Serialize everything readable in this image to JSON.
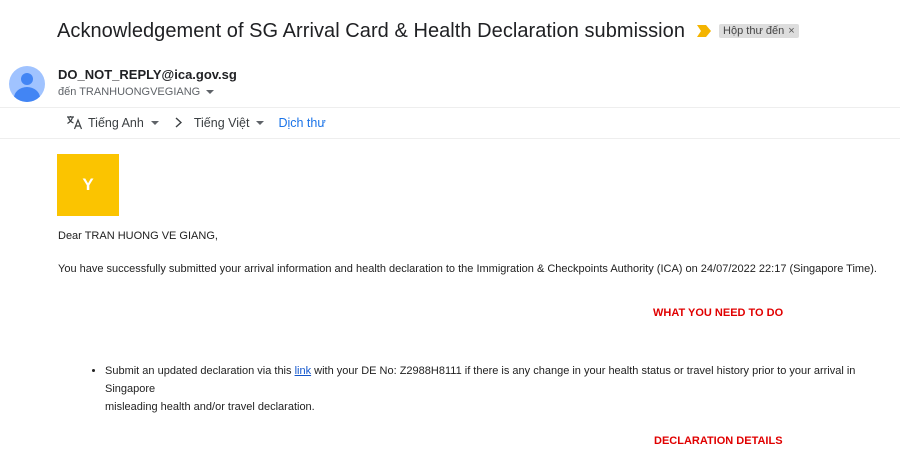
{
  "email": {
    "subject": "Acknowledgement of SG Arrival Card & Health Declaration submission",
    "label_chip": "Hộp thư đến",
    "label_remove": "×",
    "sender": "DO_NOT_REPLY@ica.gov.sg",
    "recipient": "đến TRANHUONGVEGIANG"
  },
  "translate_bar": {
    "source_lang": "Tiếng Anh",
    "target_lang": "Tiếng Việt",
    "translate_label": "Dịch thư"
  },
  "body": {
    "logo_letter": "Y",
    "greeting": "Dear TRAN HUONG VE GIANG,",
    "confirmation": "You have successfully submitted your arrival information and health declaration to the Immigration & Checkpoints Authority (ICA) on 24/07/2022 22:17 (Singapore Time).",
    "heading_todo": "WHAT YOU NEED TO DO",
    "bullet_prefix": "Submit an updated declaration via this ",
    "bullet_link": "link",
    "bullet_suffix": " with your DE No: Z2988H8111 if there is any change in your health status or travel history prior to your arrival in Singapore",
    "bullet_line2": "misleading health and/or travel declaration.",
    "heading_details": "DECLARATION DETAILS"
  },
  "colors": {
    "logo_bg": "#fbc400",
    "heading_red": "#e00000",
    "link_blue": "#1155cc",
    "importance_marker": "#f4b400"
  }
}
